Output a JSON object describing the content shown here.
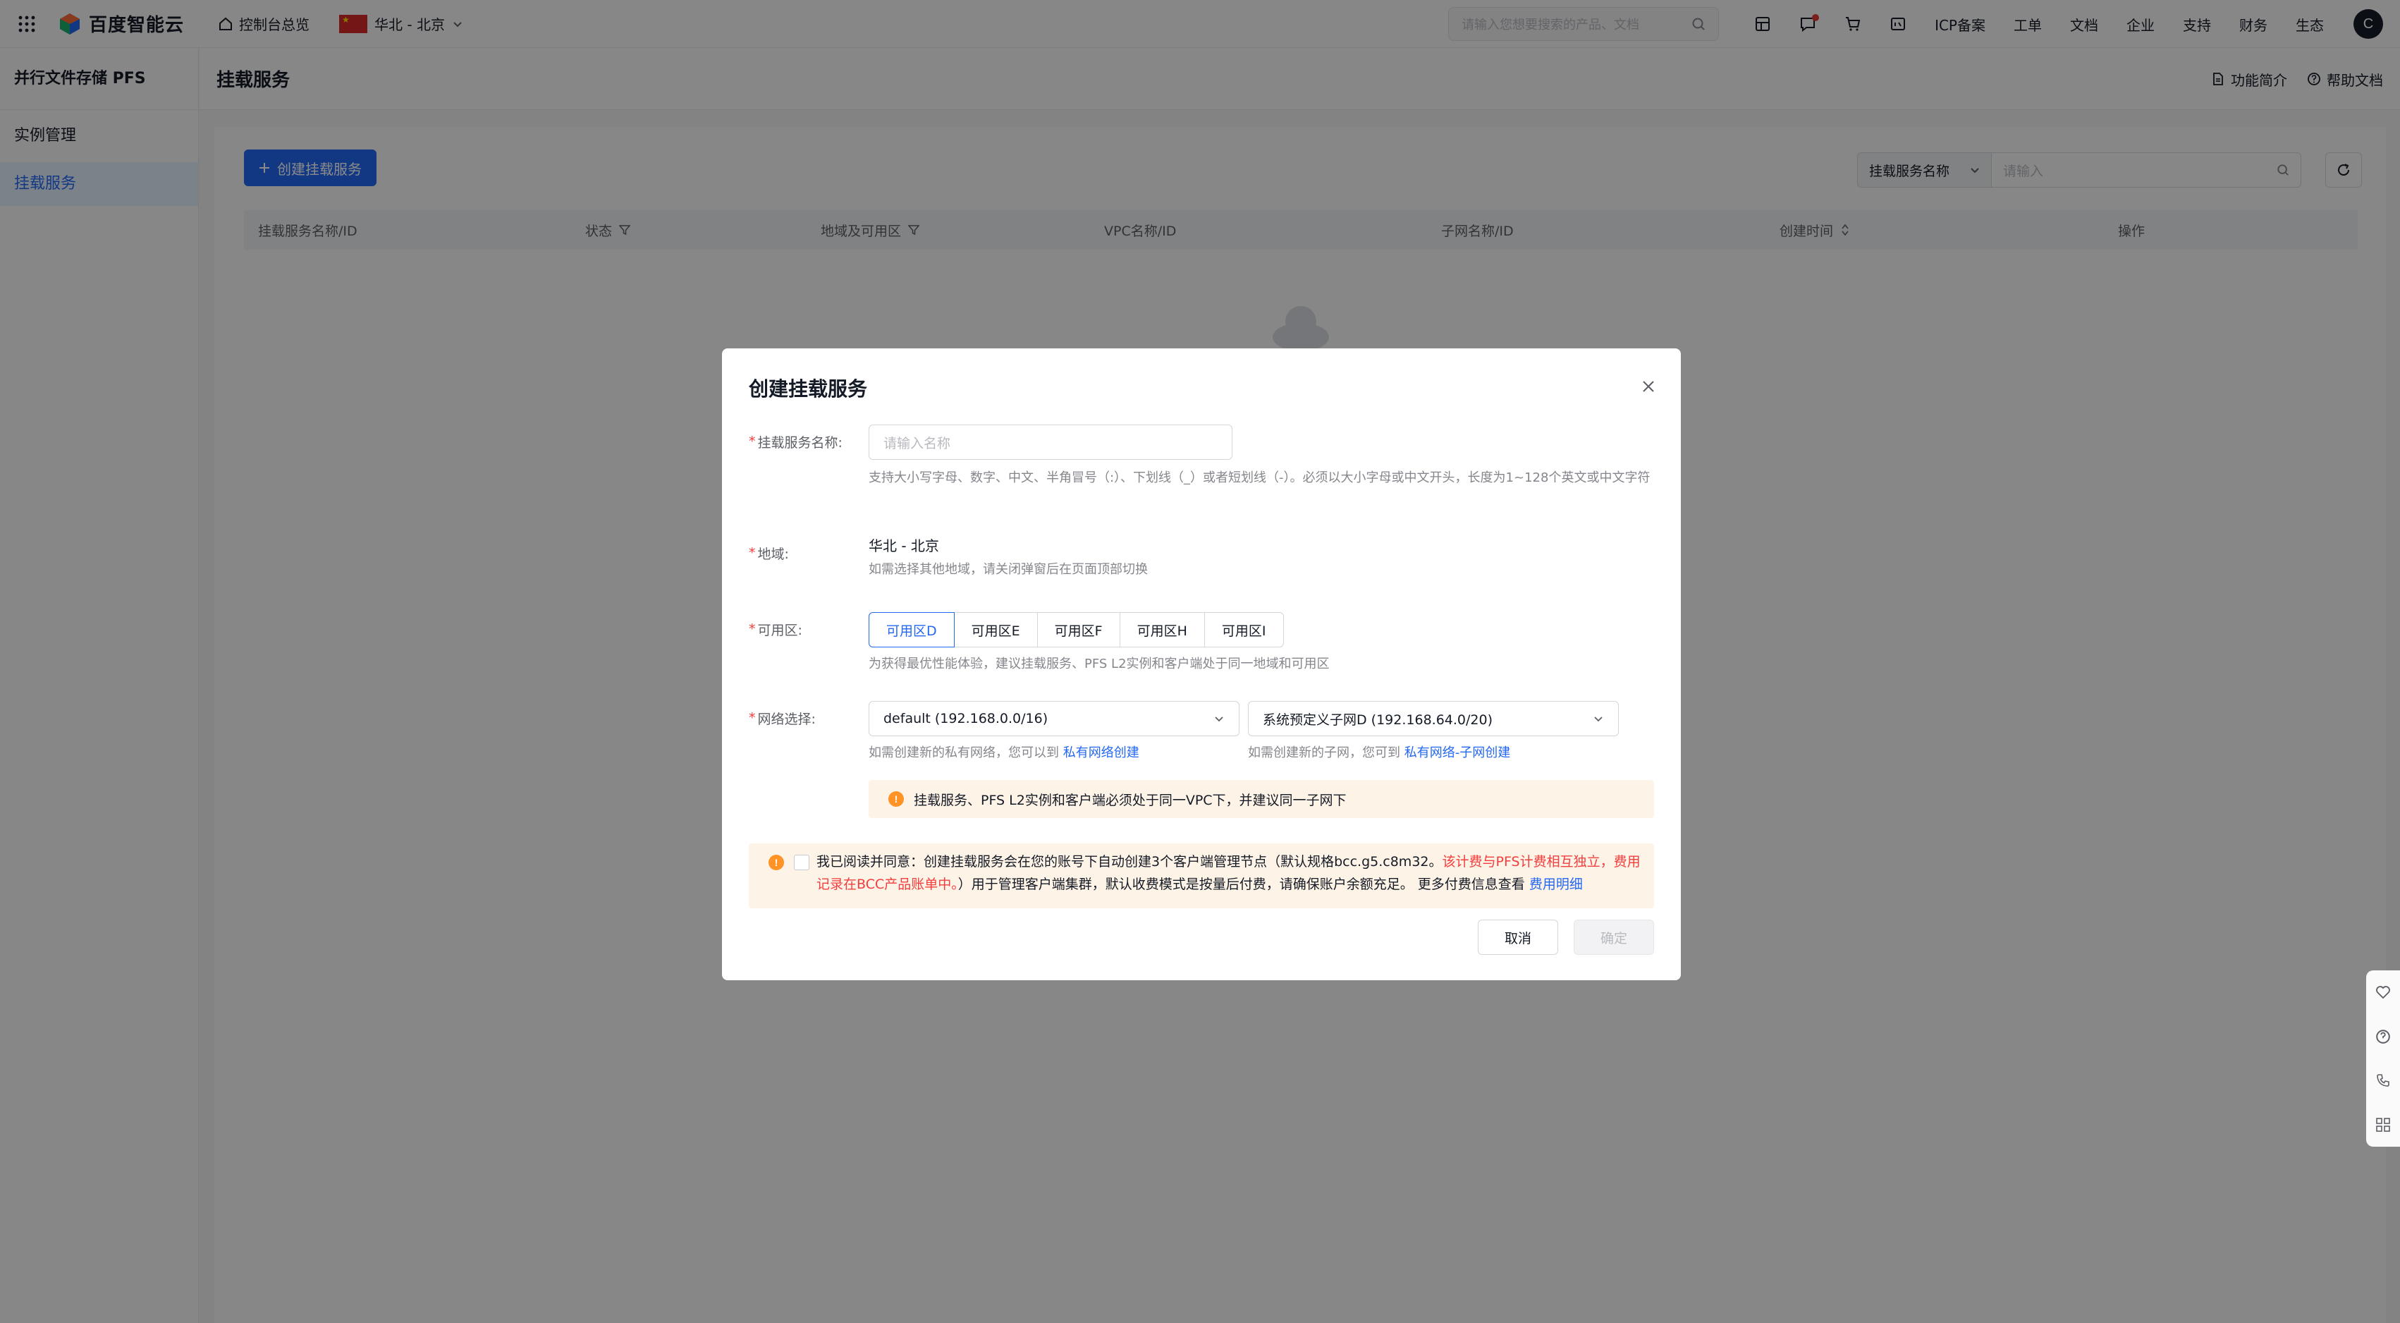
{
  "topnav": {
    "logo_text": "百度智能云",
    "console_link": "控制台总览",
    "region": "华北 - 北京",
    "search_placeholder": "请输入您想要搜索的产品、文档",
    "links": [
      "ICP备案",
      "工单",
      "文档",
      "企业",
      "支持",
      "财务",
      "生态"
    ],
    "avatar_letter": "C"
  },
  "sidebar": {
    "title": "并行文件存储 PFS",
    "items": [
      {
        "label": "实例管理",
        "active": false
      },
      {
        "label": "挂载服务",
        "active": true
      }
    ]
  },
  "page": {
    "title": "挂载服务",
    "intro_link": "功能简介",
    "help_link": "帮助文档",
    "create_button": "创建挂载服务",
    "filter_select": "挂载服务名称",
    "filter_placeholder": "请输入",
    "columns": [
      "挂载服务名称/ID",
      "状态",
      "地域及可用区",
      "VPC名称/ID",
      "子网名称/ID",
      "创建时间",
      "操作"
    ]
  },
  "modal": {
    "title": "创建挂载服务",
    "name_label": "挂载服务名称:",
    "name_placeholder": "请输入名称",
    "name_hint": "支持大小写字母、数字、中文、半角冒号（:）、下划线（_）或者短划线（-）。必须以大小字母或中文开头，长度为1~128个英文或中文字符",
    "region_label": "地域:",
    "region_value": "华北 - 北京",
    "region_hint": "如需选择其他地域，请关闭弹窗后在页面顶部切换",
    "az_label": "可用区:",
    "az_options": [
      {
        "label": "可用区D",
        "selected": true
      },
      {
        "label": "可用区E",
        "selected": false
      },
      {
        "label": "可用区F",
        "selected": false
      },
      {
        "label": "可用区H",
        "selected": false
      },
      {
        "label": "可用区I",
        "selected": false
      }
    ],
    "az_hint": "为获得最优性能体验，建议挂载服务、PFS L2实例和客户端处于同一地域和可用区",
    "network_label": "网络选择:",
    "vpc_value": "default (192.168.0.0/16)",
    "subnet_value": "系统预定义子网D (192.168.64.0/20)",
    "vpc_hint": "如需创建新的私有网络，您可以到",
    "vpc_link": "私有网络创建",
    "subnet_hint": "如需创建新的子网，您可到",
    "subnet_link": "私有网络-子网创建",
    "warning": "挂载服务、PFS L2实例和客户端必须处于同一VPC下，并建议同一子网下",
    "agree_text_1": "我已阅读并同意：创建挂载服务会在您的账号下自动创建3个客户端管理节点（默认规格bcc.g5.c8m32。",
    "agree_text_red": "该计费与PFS计费相互独立，费用记录在BCC产品账单中。",
    "agree_text_2": "）用于管理客户端集群，默认收费模式是按量后付费，请确保账户余额充足。 更多付费信息查看",
    "agree_link": "费用明细",
    "cancel_button": "取消",
    "ok_button": "确定"
  },
  "colors": {
    "primary": "#2468f2",
    "warning": "#ff9326",
    "danger": "#f33e3e"
  }
}
